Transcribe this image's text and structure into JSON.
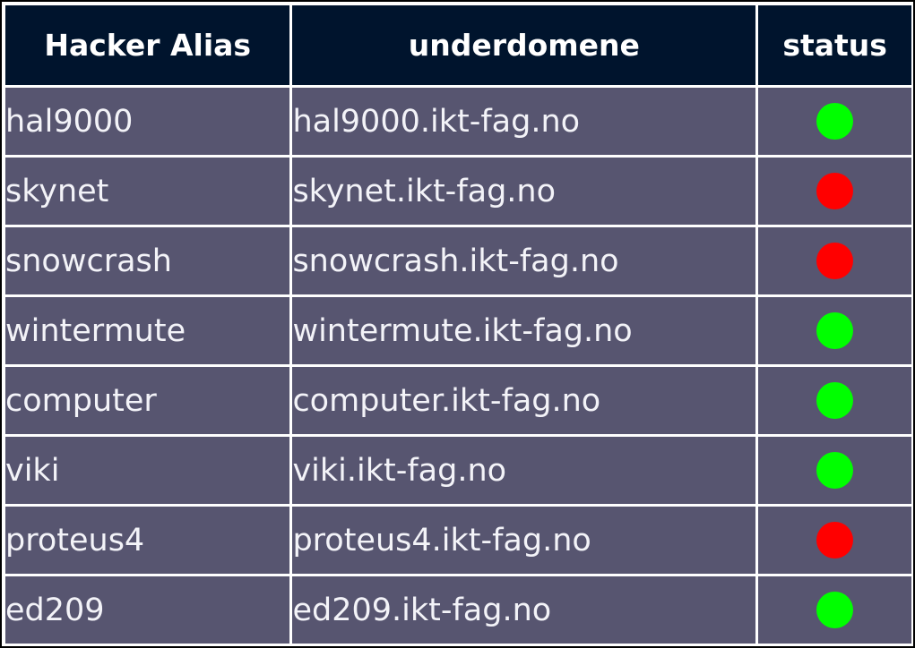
{
  "table": {
    "headers": {
      "alias": "Hacker Alias",
      "domain": "underdomene",
      "status": "status"
    },
    "rows": [
      {
        "alias": "hal9000",
        "domain": "hal9000.ikt-fag.no",
        "status": "up"
      },
      {
        "alias": "skynet",
        "domain": "skynet.ikt-fag.no",
        "status": "down"
      },
      {
        "alias": "snowcrash",
        "domain": "snowcrash.ikt-fag.no",
        "status": "down"
      },
      {
        "alias": "wintermute",
        "domain": "wintermute.ikt-fag.no",
        "status": "up"
      },
      {
        "alias": "computer",
        "domain": "computer.ikt-fag.no",
        "status": "up"
      },
      {
        "alias": "viki",
        "domain": "viki.ikt-fag.no",
        "status": "up"
      },
      {
        "alias": "proteus4",
        "domain": "proteus4.ikt-fag.no",
        "status": "down"
      },
      {
        "alias": "ed209",
        "domain": "ed209.ikt-fag.no",
        "status": "up"
      }
    ]
  },
  "colors": {
    "header_bg": "#00142d",
    "row_bg": "#575570",
    "text": "#f3f3f8",
    "status_up": "#00ff00",
    "status_down": "#ff0000"
  }
}
